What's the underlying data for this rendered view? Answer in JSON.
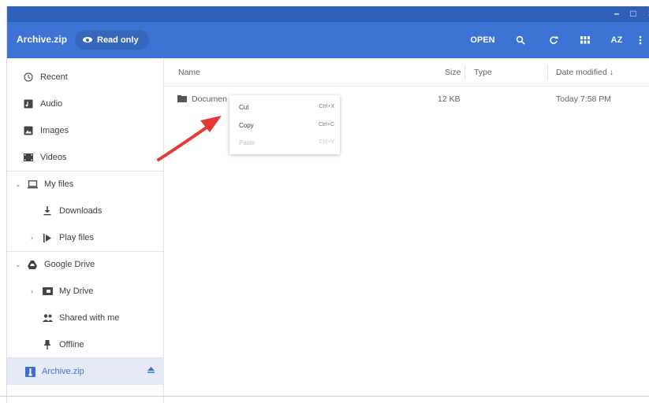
{
  "window": {
    "controls": {
      "minimize": "–",
      "maximize": "□",
      "close": "×"
    }
  },
  "toolbar": {
    "title": "Archive.zip",
    "readonly_label": "Read only",
    "open_label": "OPEN",
    "search_icon": "search-icon",
    "refresh_icon": "refresh-icon",
    "grid_icon": "grid-view-icon",
    "sort_label": "AZ",
    "more_icon": "more-vert-icon"
  },
  "sidebar": {
    "recent": "Recent",
    "audio": "Audio",
    "images": "Images",
    "videos": "Videos",
    "my_files": "My files",
    "downloads": "Downloads",
    "play_files": "Play files",
    "google_drive": "Google Drive",
    "my_drive": "My Drive",
    "shared_with_me": "Shared with me",
    "offline": "Offline",
    "archive": "Archive.zip"
  },
  "columns": {
    "name": "Name",
    "size": "Size",
    "type": "Type",
    "date": "Date modified ↓"
  },
  "files": [
    {
      "name": "Documen",
      "size": "12 KB",
      "type": "",
      "date": "Today 7:58 PM"
    }
  ],
  "context_menu": {
    "items": [
      {
        "label": "Cut",
        "shortcut": "Ctrl+X",
        "enabled": true
      },
      {
        "label": "Copy",
        "shortcut": "Ctrl+C",
        "enabled": true
      },
      {
        "label": "Paste",
        "shortcut": "Ctrl+V",
        "enabled": false
      }
    ]
  },
  "colors": {
    "titlebar": "#2f5fb8",
    "toolbar": "#3d73d4",
    "accent": "#3d6ed6",
    "active_bg": "#e6eaf7",
    "arrow": "#e53935"
  }
}
